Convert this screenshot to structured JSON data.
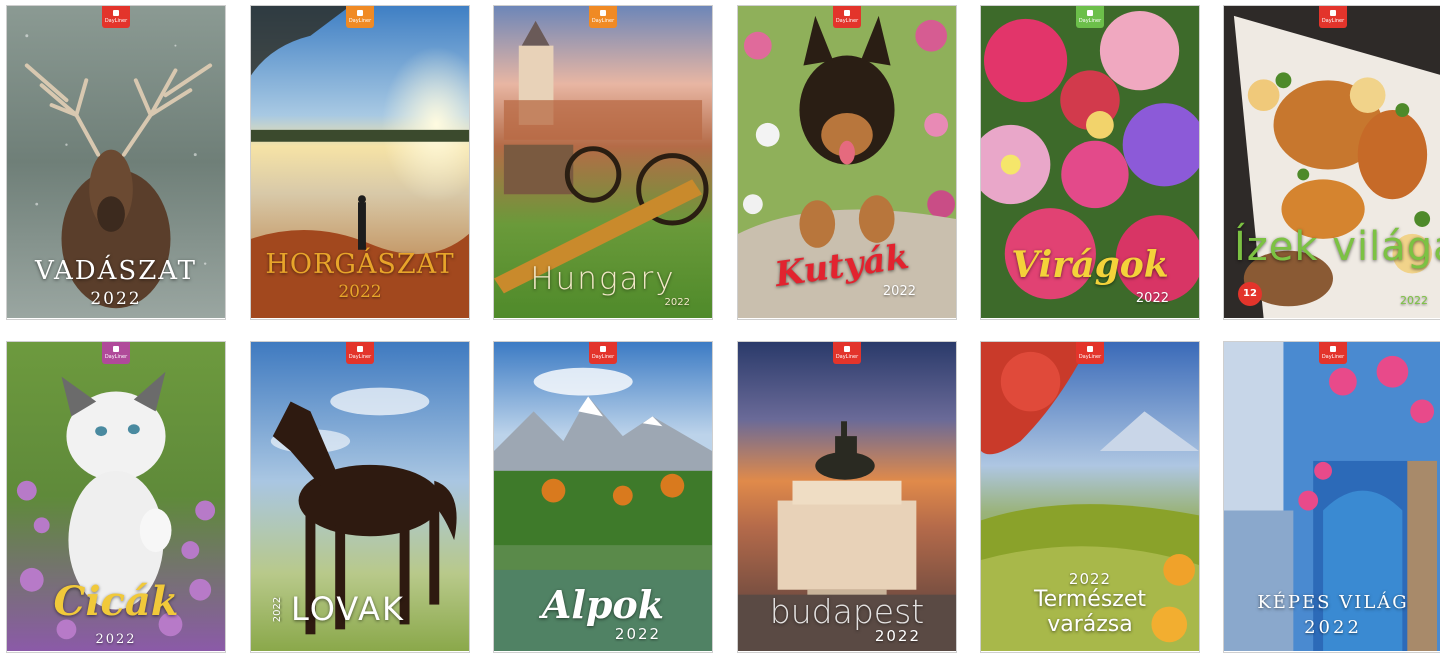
{
  "brand_badge": "DayLiner",
  "calendars": [
    {
      "title": "VADÁSZAT",
      "year": "2022",
      "badge_color": "#e3342b"
    },
    {
      "title": "HORGÁSZAT",
      "year": "2022",
      "badge_color": "#f08a24"
    },
    {
      "title": "Hungary",
      "year": "2022",
      "badge_color": "#f08a24"
    },
    {
      "title": "Kutyák",
      "year": "2022",
      "badge_color": "#e3342b"
    },
    {
      "title": "Virágok",
      "year": "2022",
      "badge_color": "#6cbf4a"
    },
    {
      "title": "Ízek világa",
      "year": "2022",
      "badge_color": "#e3342b",
      "sticker": "12"
    },
    {
      "title": "Cicák",
      "year": "2022",
      "badge_color": "#b04a9a"
    },
    {
      "title": "LOVAK",
      "year": "2022",
      "badge_color": "#e3342b"
    },
    {
      "title": "Alpok",
      "year": "2022",
      "badge_color": "#e3342b"
    },
    {
      "title": "budapest",
      "year": "2022",
      "badge_color": "#e3342b"
    },
    {
      "title_line1": "Természet",
      "title_line2": "varázsa",
      "year": "2022",
      "badge_color": "#e3342b"
    },
    {
      "title": "KÉPES VILÁG",
      "year": "2022",
      "badge_color": "#e3342b"
    }
  ]
}
